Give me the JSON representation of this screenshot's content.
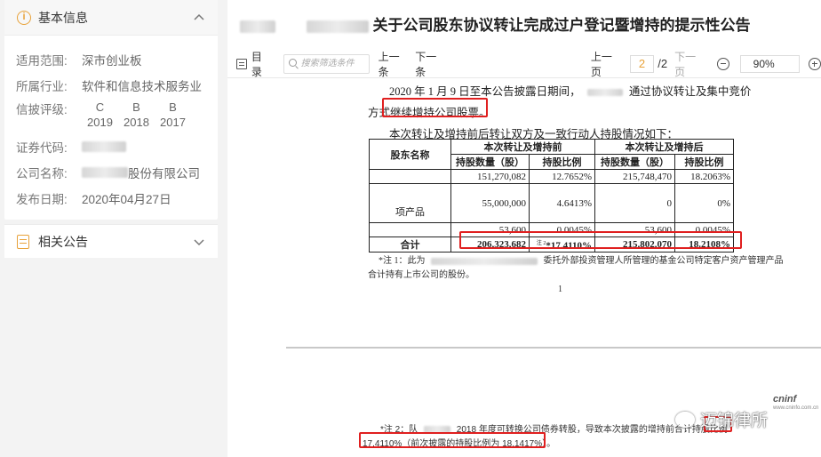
{
  "sidebar": {
    "basic_info_title": "基本信息",
    "rows": [
      {
        "label": "适用范围:",
        "value": "深市创业板"
      },
      {
        "label": "所属行业:",
        "value": "软件和信息技术服务业"
      }
    ],
    "rating_label": "信披评级:",
    "ratings": [
      {
        "grade": "C",
        "year": "2019"
      },
      {
        "grade": "B",
        "year": "2018"
      },
      {
        "grade": "B",
        "year": "2017"
      }
    ],
    "code_label": "证券代码:",
    "company_label": "公司名称:",
    "company_suffix": "股份有限公司",
    "date_label": "发布日期:",
    "date_value": "2020年04月27日",
    "related_title": "相关公告"
  },
  "document": {
    "title": "关于公司股东协议转让完成过户登记暨增持的提示性公告",
    "toolbar": {
      "toc": "目录",
      "search_placeholder": "搜索筛选条件",
      "prev_hit": "上一条",
      "next_hit": "下一条",
      "prev_page": "上一页",
      "page_current": "2",
      "page_total": "/2",
      "next_page": "下一页",
      "zoom": "90%"
    },
    "line1_a": "2020 年 1 月 9 日至本公告披露日期间，",
    "line1_b": "通过协议转让及集中竞价",
    "line2_a": "方式",
    "line2_b": "继续增持公司股票。",
    "line3": "本次转让及增持前后转让双方及一致行动人持股情况如下：",
    "table": {
      "h_name": "股东名称",
      "h_before": "本次转让及增持前",
      "h_after": "本次转让及增持后",
      "h_qty": "持股数量（股）",
      "h_ratio": "持股比例",
      "rows": [
        [
          "151,270,082",
          "12.7652%",
          "215,748,470",
          "18.2063%"
        ],
        [
          "55,000,000",
          "4.6413%",
          "0",
          "0%"
        ],
        [
          "53,600",
          "0.0045%",
          "53,600",
          "0.0045%"
        ]
      ],
      "product_label": "项产品",
      "total_label": "合计",
      "total": [
        "206,323,682",
        "17.4110%",
        "215,802,070",
        "18.2108%"
      ],
      "total_note_mark": "注 2"
    },
    "note1_a": "*注 1：此为",
    "note1_b": "委托外部投资管理人所管理的基金公司特定客户资产管理产品",
    "note1_c": "合计持有上市公司的股份。",
    "page_number": "1",
    "logo": "cninf",
    "logo_sub": "www.cninfo.com.cn",
    "note2_a": "*注 2：队",
    "note2_b": "2018 年度可转换公司债券转股，导致本次披露的增持前合计持股比例",
    "note2_c": "17.4110%（前次披露的持股比例为 18.1417%）。",
    "watermark": "迈锦律所"
  }
}
